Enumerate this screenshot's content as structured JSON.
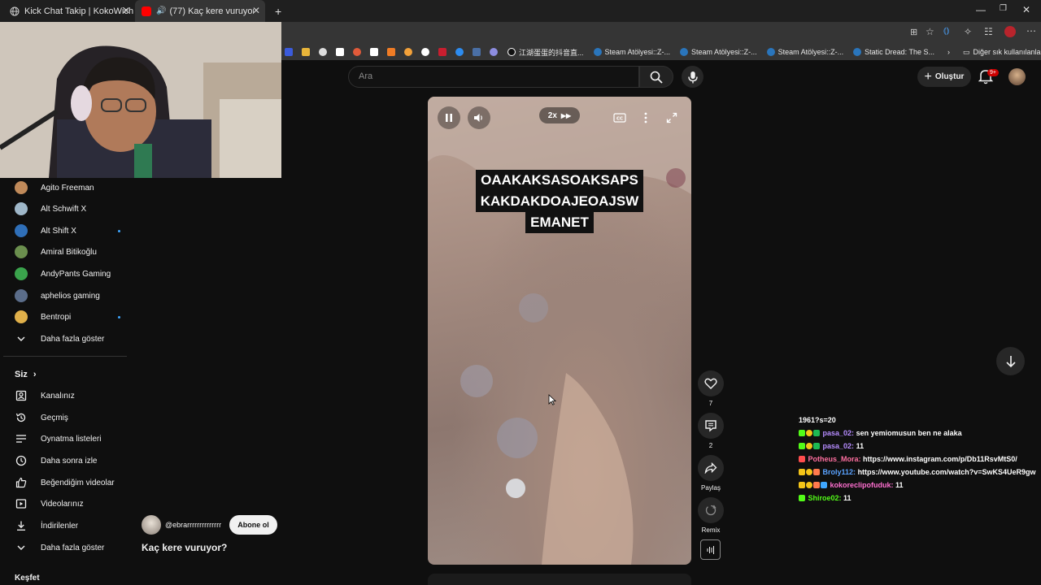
{
  "browser": {
    "tabs": [
      {
        "title": "Kick Chat Takip | KokoWich"
      },
      {
        "title": "(77) Kaç kere vuruyor? - YouTube"
      }
    ],
    "new_tab": "+",
    "bookmarks": [
      {
        "label": "江湖蛋蛋的抖音直..."
      },
      {
        "label": "Steam Atölyesi::Z-..."
      },
      {
        "label": "Steam Atölyesi::Z-..."
      },
      {
        "label": "Steam Atölyesi::Z-..."
      },
      {
        "label": "Static Dread: The S..."
      }
    ],
    "other_bookmarks": "Diğer sık kullanılanlar"
  },
  "header": {
    "search_placeholder": "Ara",
    "create_label": "Oluştur",
    "notification_count": "9+"
  },
  "sidebar": {
    "subscriptions": [
      {
        "name": "Agito Freeman",
        "color": "#c08a5a",
        "live": false
      },
      {
        "name": "Alt Schwift X",
        "color": "#9fb7c9",
        "live": false
      },
      {
        "name": "Alt Shift X",
        "color": "#2f6fb8",
        "live": true
      },
      {
        "name": "Amiral Bitikoğlu",
        "color": "#6b8f4e",
        "live": false
      },
      {
        "name": "AndyPants Gaming",
        "color": "#3aa34c",
        "live": false
      },
      {
        "name": "aphelios gaming",
        "color": "#5b6d8a",
        "live": false
      },
      {
        "name": "Bentropi",
        "color": "#e0b04a",
        "live": true
      }
    ],
    "show_more": "Daha fazla göster",
    "you_section": "Siz",
    "you_items": [
      {
        "label": "Kanalınız",
        "icon": "channel-icon"
      },
      {
        "label": "Geçmiş",
        "icon": "history-icon"
      },
      {
        "label": "Oynatma listeleri",
        "icon": "playlist-icon"
      },
      {
        "label": "Daha sonra izle",
        "icon": "clock-icon"
      },
      {
        "label": "Beğendiğim videolar",
        "icon": "thumbs-up-icon"
      },
      {
        "label": "Videolarınız",
        "icon": "video-icon"
      },
      {
        "label": "İndirilenler",
        "icon": "download-icon"
      }
    ],
    "show_more_2": "Daha fazla göster",
    "explore": "Keşfet"
  },
  "video": {
    "speed_label": "2x",
    "caption_lines": [
      "OAAKAKSASOAKSAPS",
      "KAKDAKDOAJEOAJSW",
      "EMANET"
    ],
    "channel_handle": "@ebrarrrrrrrrrrrrrr",
    "subscribe_label": "Abone ol",
    "title": "Kaç kere vuruyor?"
  },
  "actions": {
    "like_count": "7",
    "comment_count": "2",
    "share_label": "Paylaş",
    "remix_label": "Remix"
  },
  "chat": {
    "lines": [
      {
        "user": "",
        "user_color": "#ffffff",
        "message": "1961?s=20"
      },
      {
        "user": "pasa_02:",
        "user_color": "#b68cff",
        "message": "sen yemiomusun ben ne alaka"
      },
      {
        "user": "pasa_02:",
        "user_color": "#b68cff",
        "message": "11"
      },
      {
        "user": "Potheus_Mora:",
        "user_color": "#ff6fa0",
        "message": "https://www.instagram.com/p/Db11RsvMtS0/"
      },
      {
        "user": "Broly112:",
        "user_color": "#5aa2ff",
        "message": "https://www.youtube.com/watch?v=SwKS4UeR9gw"
      },
      {
        "user": "kokoreclipofuduk:",
        "user_color": "#ff6fd0",
        "message": "11"
      },
      {
        "user": "Shiroe02:",
        "user_color": "#53fc18",
        "message": "11"
      }
    ]
  }
}
